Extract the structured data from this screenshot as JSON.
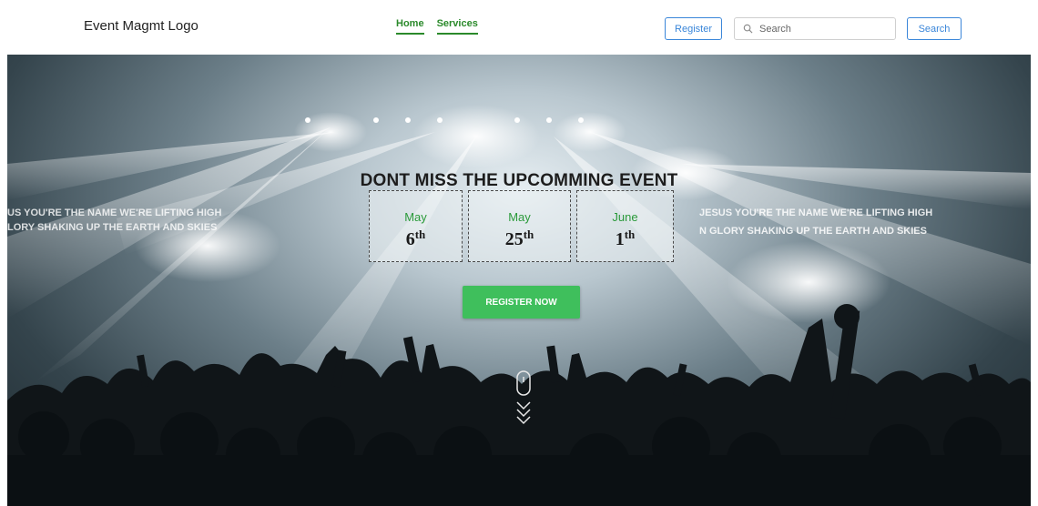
{
  "header": {
    "logo": "Event Magmt Logo",
    "nav": [
      {
        "label": "Home"
      },
      {
        "label": "Services"
      }
    ],
    "register_label": "Register",
    "search_placeholder": "Search",
    "search_button_label": "Search"
  },
  "hero": {
    "title": "DONT MISS THE UPCOMMING EVENT",
    "dates": [
      {
        "month": "May",
        "day": "6",
        "suffix": "th"
      },
      {
        "month": "May",
        "day": "25",
        "suffix": "th"
      },
      {
        "month": "June",
        "day": "1",
        "suffix": "th"
      }
    ],
    "cta_label": "REGISTER NOW",
    "banner_text_left_1": "US YOU'RE THE NAME WE'RE LIFTING HIGH",
    "banner_text_left_2": "LORY SHAKING UP THE EARTH AND SKIES",
    "banner_text_right_1": "JESUS YOU'RE THE NAME WE'RE LIFTING HIGH",
    "banner_text_right_2": "N GLORY SHAKING UP THE EARTH AND SKIES"
  },
  "colors": {
    "brand_green": "#3fbf5c",
    "nav_green": "#2b8a2b",
    "outline_blue": "#3a86d9"
  }
}
